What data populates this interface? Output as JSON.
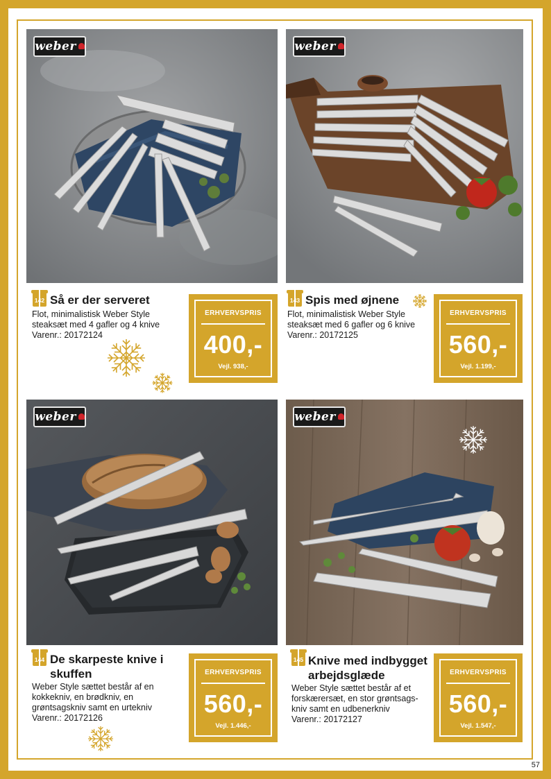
{
  "page_number": "57",
  "brand_logo_text": "weber",
  "colors": {
    "gold": "#d4a52b",
    "white": "#ffffff",
    "text": "#1a1a1a"
  },
  "products": [
    {
      "badge": "142",
      "title": "Så er der serveret",
      "desc": [
        "Flot, minimalistisk Weber Style",
        "steaksæt med 4 gafler og 4 knive",
        "Varenr.: 20172124"
      ],
      "price_label": "ERHVERVSPRIS",
      "price": "400,-",
      "old_price": "Vejl. 938,-"
    },
    {
      "badge": "143",
      "title": "Spis med øjnene",
      "desc": [
        "Flot, minimalistisk Weber Style",
        "steaksæt med 6 gafler og 6 knive",
        "Varenr.: 20172125"
      ],
      "price_label": "ERHVERVSPRIS",
      "price": "560,-",
      "old_price": "Vejl. 1.199,-"
    },
    {
      "badge": "144",
      "title_lines": [
        "De skarpeste knive i",
        "skuffen"
      ],
      "desc": [
        "Weber Style sættet består af en",
        "kokkekniv, en brødkniv, en",
        "grøntsagskniv samt en urtekniv",
        "Varenr.: 20172126"
      ],
      "price_label": "ERHVERVSPRIS",
      "price": "560,-",
      "old_price": "Vejl. 1.446,-"
    },
    {
      "badge": "145",
      "title_lines": [
        "Knive med indbygget",
        "arbejdsglæde"
      ],
      "desc": [
        "Weber Style sættet består af et",
        "forskærersæt, en stor grøntsags-",
        "kniv samt en udbenerkniv",
        "Varenr.: 20172127"
      ],
      "price_label": "ERHVERVSPRIS",
      "price": "560,-",
      "old_price": "Vejl. 1.547,-"
    }
  ]
}
